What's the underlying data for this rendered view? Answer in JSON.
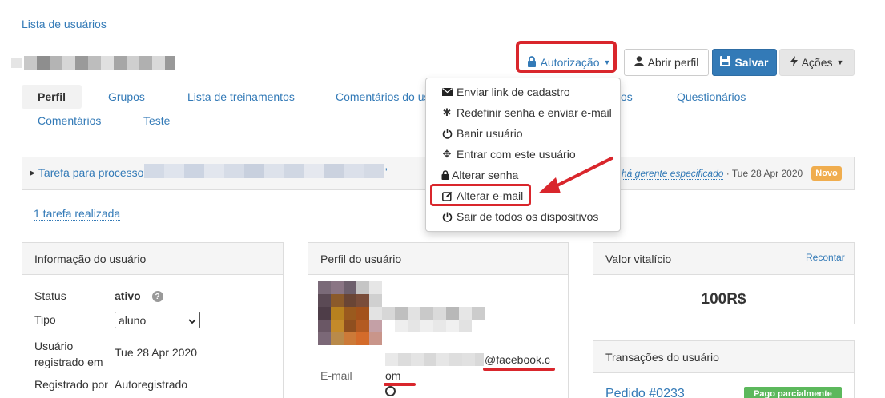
{
  "breadcrumb": "Lista de usuários",
  "buttons": {
    "authorization": "Autorização",
    "open_profile": "Abrir perfil",
    "save": "Salvar",
    "actions": "Ações"
  },
  "tabs": [
    {
      "label": "Perfil"
    },
    {
      "label": "Grupos"
    },
    {
      "label": "Lista de treinamentos"
    },
    {
      "label": "Comentários do us"
    },
    {
      "label": "os"
    },
    {
      "label": "Questionários"
    },
    {
      "label": "Comentários"
    },
    {
      "label": "Teste"
    }
  ],
  "task": {
    "title": "Tarefa para processo '",
    "quote_end": "'",
    "manager_text": "há gerente especificado",
    "separator": " · ",
    "date": "Tue 28 Apr 2020",
    "badge": "Novo",
    "done_link": "1 tarefa realizada"
  },
  "dropdown": {
    "items": [
      {
        "label": "Enviar link de cadastro",
        "icon": "envelope-icon"
      },
      {
        "label": "Redefinir senha e enviar e-mail",
        "icon": "asterisk-icon"
      },
      {
        "label": "Banir usuário",
        "icon": "power-icon"
      },
      {
        "label": "Entrar com este usuário",
        "icon": "move-icon"
      },
      {
        "label": "Alterar senha",
        "icon": "lock-icon"
      },
      {
        "label": "Alterar e-mail",
        "icon": "edit-icon"
      },
      {
        "label": "Sair de todos os dispositivos",
        "icon": "power-icon"
      }
    ]
  },
  "user_info": {
    "header": "Informação do usuário",
    "status_label": "Status",
    "status_value": "ativo",
    "type_label": "Tipo",
    "type_value": "aluno",
    "registered_label_1": "Usuário",
    "registered_label_2": "registrado em",
    "registered_value": "Tue 28 Apr 2020",
    "registered_by_label": "Registrado por",
    "registered_by_value": "Autoregistrado"
  },
  "profile": {
    "header": "Perfil do usuário",
    "email_label": "E-mail",
    "email_suffix_1": "@facebook.c",
    "email_suffix_2": "om"
  },
  "lifetime": {
    "header": "Valor vitalício",
    "recount": "Recontar",
    "value": "100R$"
  },
  "transactions": {
    "header": "Transações do usuário",
    "order": "Pedido #0233",
    "badge": "Pago parcialmente"
  },
  "colors": {
    "accent": "#337ab7",
    "annotation_red": "#d9262c",
    "badge_orange": "#f0ad4e",
    "badge_green": "#5cb85c"
  }
}
